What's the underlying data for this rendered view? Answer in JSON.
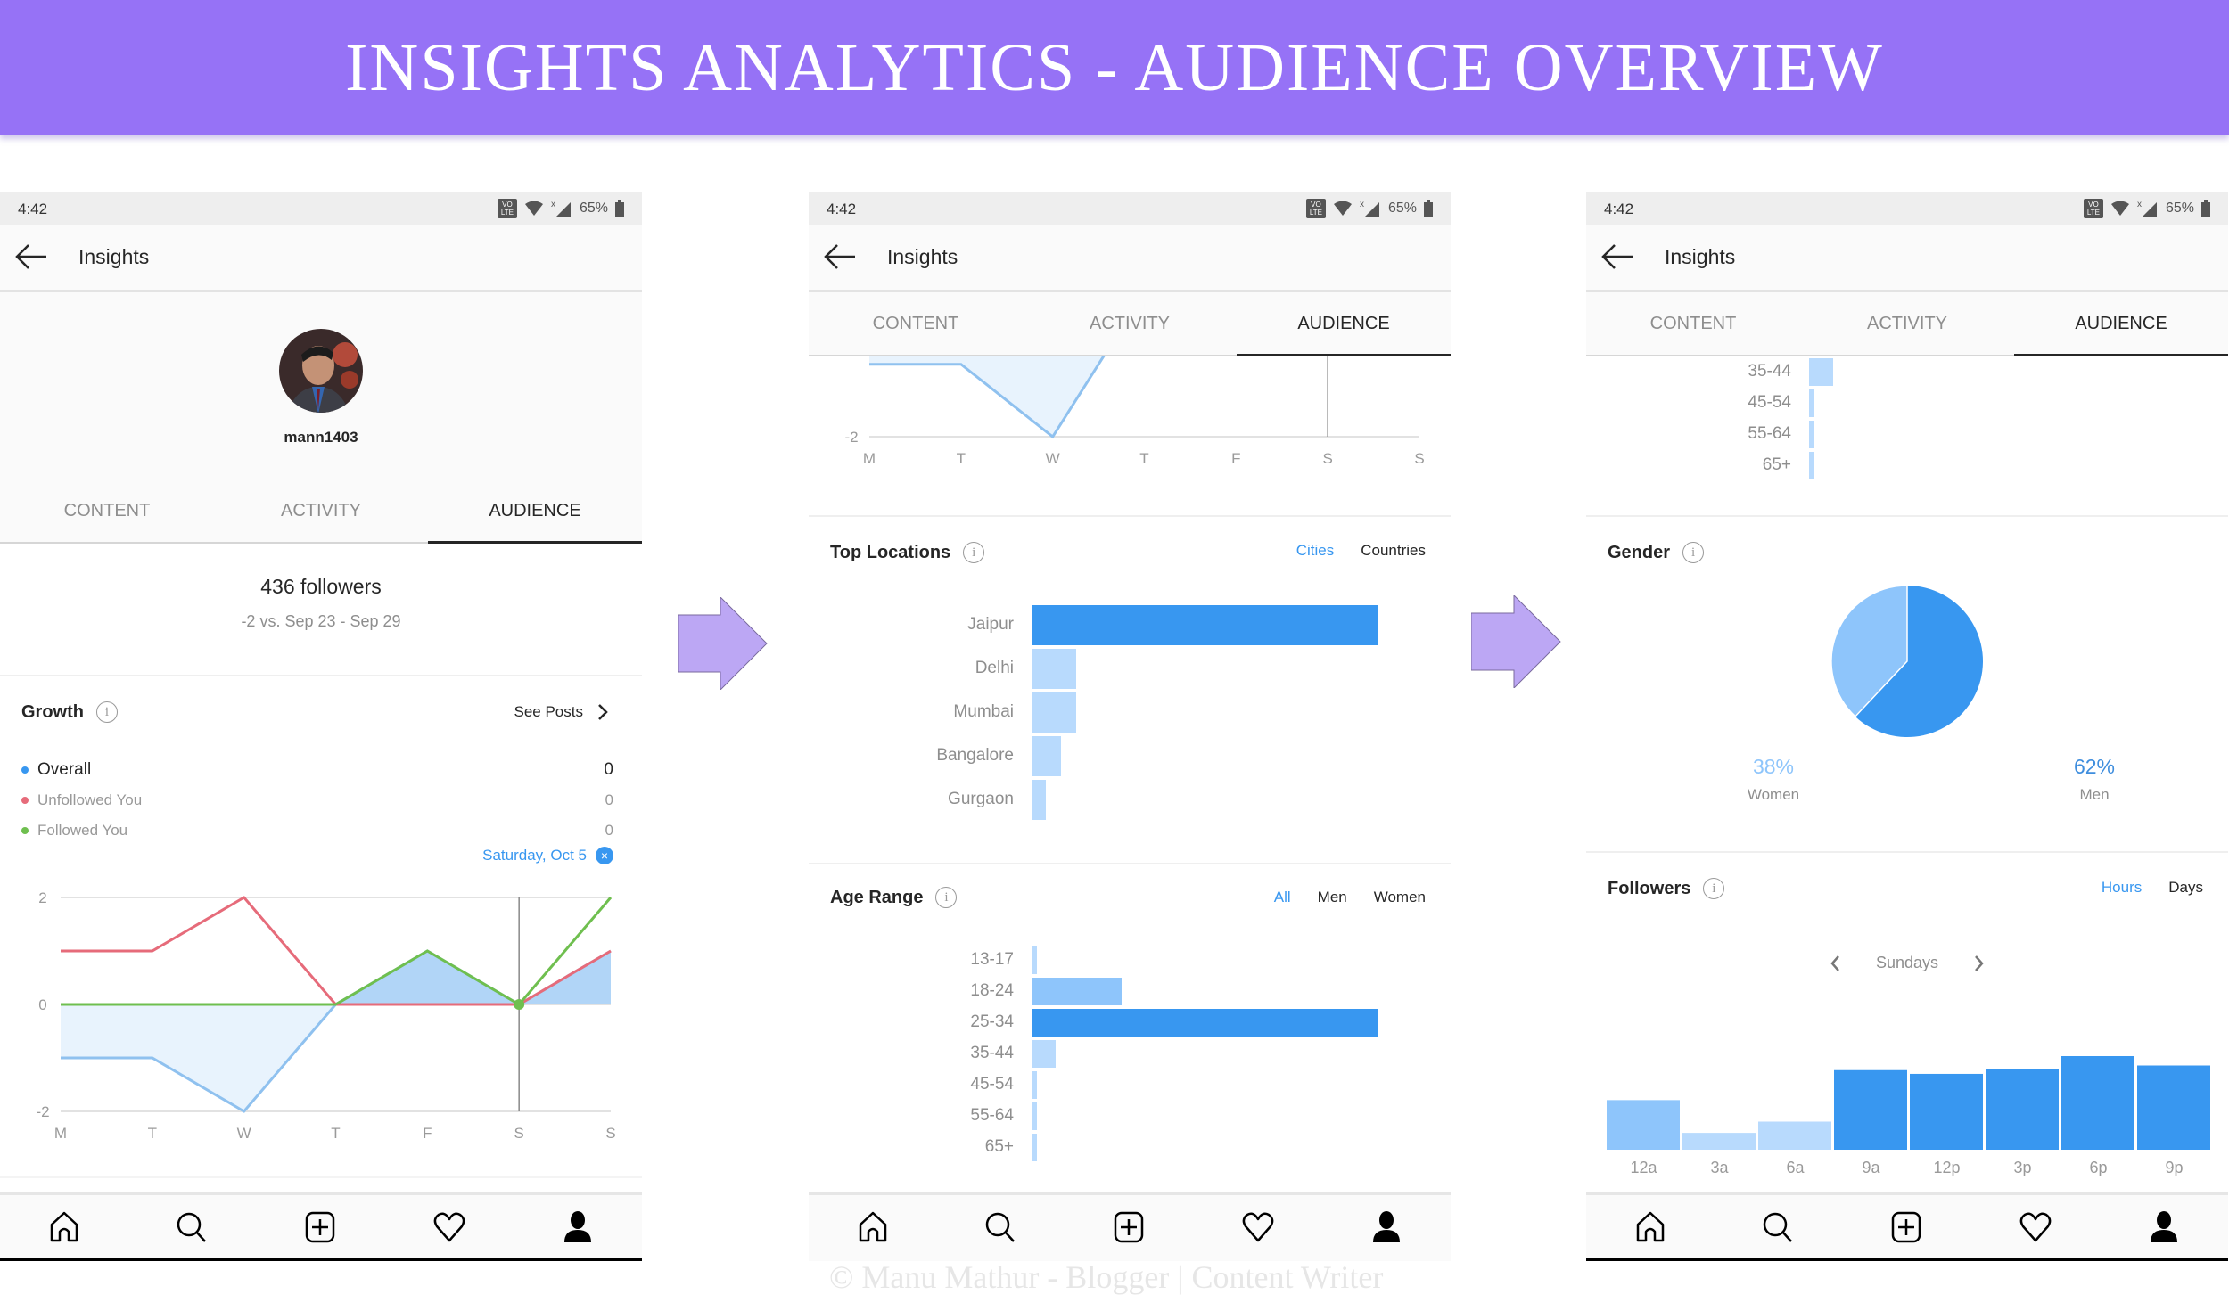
{
  "banner": {
    "title": "INSIGHTS ANALYTICS - AUDIENCE OVERVIEW"
  },
  "colors": {
    "banner": "#9672f6",
    "arrow": "#bca7f4",
    "accent_blue": "#3897f0",
    "bar_dark": "#3897f0",
    "bar_mid": "#8ec5fb",
    "bar_light": "#b8dafd",
    "line_overall": "#8fc1ef",
    "line_unfollowed": "#e66b7a",
    "line_followed": "#6fbf4f"
  },
  "status_bar": {
    "time": "4:42",
    "volte": "VO LTE",
    "battery": "65%"
  },
  "app_bar": {
    "title": "Insights"
  },
  "tabs": [
    "CONTENT",
    "ACTIVITY",
    "AUDIENCE"
  ],
  "active_tab": "AUDIENCE",
  "screen1": {
    "username": "mann1403",
    "followers": "436 followers",
    "followers_delta": "-2 vs. Sep 23 - Sep 29",
    "growth": {
      "title": "Growth",
      "see_posts": "See Posts",
      "legend": [
        {
          "label": "Overall",
          "value": "0",
          "color": "#3897f0"
        },
        {
          "label": "Unfollowed You",
          "value": "0",
          "color": "#e66b7a"
        },
        {
          "label": "Followed You",
          "value": "0",
          "color": "#6fbf4f"
        }
      ],
      "selected_date": "Saturday, Oct 5"
    },
    "next_section_title": "Top Locations",
    "next_section_toggles": [
      "Cities",
      "Countries"
    ]
  },
  "screen2": {
    "top_locations": {
      "title": "Top Locations",
      "toggles": [
        "Cities",
        "Countries"
      ],
      "active": "Cities"
    },
    "age_range": {
      "title": "Age Range",
      "toggles": [
        "All",
        "Men",
        "Women"
      ],
      "active": "All"
    }
  },
  "screen3": {
    "gender": {
      "title": "Gender",
      "women_pct": "38%",
      "women_label": "Women",
      "men_pct": "62%",
      "men_label": "Men"
    },
    "followers": {
      "title": "Followers",
      "toggles": [
        "Hours",
        "Days"
      ],
      "active": "Hours",
      "day": "Sundays"
    }
  },
  "nav_icons": [
    "home-icon",
    "search-icon",
    "add-post-icon",
    "heart-icon",
    "profile-icon"
  ],
  "watermark": "© Manu Mathur - Blogger | Content Writer",
  "chart_data": [
    {
      "id": "growth",
      "type": "line",
      "title": "Growth",
      "categories": [
        "M",
        "T",
        "W",
        "T",
        "F",
        "S",
        "S"
      ],
      "series": [
        {
          "name": "Overall",
          "values": [
            -1,
            -1,
            -2,
            0,
            1,
            0,
            1
          ]
        },
        {
          "name": "Unfollowed You",
          "values": [
            1,
            1,
            2,
            0,
            0,
            0,
            1
          ]
        },
        {
          "name": "Followed You",
          "values": [
            0,
            0,
            0,
            0,
            1,
            0,
            2
          ]
        }
      ],
      "yticks": [
        2,
        0,
        -2
      ],
      "ylim": [
        -2,
        2
      ],
      "highlight_index": 5,
      "grid": true
    },
    {
      "id": "top_locations",
      "type": "bar",
      "orientation": "horizontal",
      "title": "Top Locations",
      "categories": [
        "Jaipur",
        "Delhi",
        "Mumbai",
        "Bangalore",
        "Gurgaon"
      ],
      "values": [
        100,
        13,
        13,
        8.6,
        4.2
      ],
      "units": "relative %"
    },
    {
      "id": "age_range",
      "type": "bar",
      "orientation": "horizontal",
      "title": "Age Range",
      "categories": [
        "13-17",
        "18-24",
        "25-34",
        "35-44",
        "45-54",
        "55-64",
        "65+"
      ],
      "values": [
        1.3,
        26,
        100,
        7,
        1.3,
        1.3,
        1.3
      ],
      "units": "relative %"
    },
    {
      "id": "gender",
      "type": "pie",
      "title": "Gender",
      "categories": [
        "Women",
        "Men"
      ],
      "values": [
        38,
        62
      ]
    },
    {
      "id": "followers_hours",
      "type": "bar",
      "title": "Followers",
      "categories": [
        "12a",
        "3a",
        "6a",
        "9a",
        "12p",
        "3p",
        "6p",
        "9p"
      ],
      "values": [
        53,
        18,
        30,
        85,
        81,
        86,
        100,
        90
      ],
      "units": "relative %"
    }
  ]
}
